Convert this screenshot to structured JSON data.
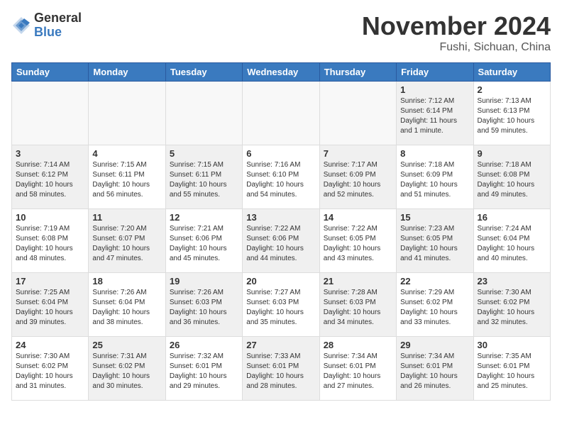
{
  "header": {
    "logo_general": "General",
    "logo_blue": "Blue",
    "month_title": "November 2024",
    "location": "Fushi, Sichuan, China"
  },
  "days_of_week": [
    "Sunday",
    "Monday",
    "Tuesday",
    "Wednesday",
    "Thursday",
    "Friday",
    "Saturday"
  ],
  "weeks": [
    [
      {
        "day": "",
        "info": "",
        "empty": true
      },
      {
        "day": "",
        "info": "",
        "empty": true
      },
      {
        "day": "",
        "info": "",
        "empty": true
      },
      {
        "day": "",
        "info": "",
        "empty": true
      },
      {
        "day": "",
        "info": "",
        "empty": true
      },
      {
        "day": "1",
        "info": "Sunrise: 7:12 AM\nSunset: 6:14 PM\nDaylight: 11 hours and 1 minute.",
        "shaded": true
      },
      {
        "day": "2",
        "info": "Sunrise: 7:13 AM\nSunset: 6:13 PM\nDaylight: 10 hours and 59 minutes.",
        "shaded": false
      }
    ],
    [
      {
        "day": "3",
        "info": "Sunrise: 7:14 AM\nSunset: 6:12 PM\nDaylight: 10 hours and 58 minutes.",
        "shaded": true
      },
      {
        "day": "4",
        "info": "Sunrise: 7:15 AM\nSunset: 6:11 PM\nDaylight: 10 hours and 56 minutes.",
        "shaded": false
      },
      {
        "day": "5",
        "info": "Sunrise: 7:15 AM\nSunset: 6:11 PM\nDaylight: 10 hours and 55 minutes.",
        "shaded": true
      },
      {
        "day": "6",
        "info": "Sunrise: 7:16 AM\nSunset: 6:10 PM\nDaylight: 10 hours and 54 minutes.",
        "shaded": false
      },
      {
        "day": "7",
        "info": "Sunrise: 7:17 AM\nSunset: 6:09 PM\nDaylight: 10 hours and 52 minutes.",
        "shaded": true
      },
      {
        "day": "8",
        "info": "Sunrise: 7:18 AM\nSunset: 6:09 PM\nDaylight: 10 hours and 51 minutes.",
        "shaded": false
      },
      {
        "day": "9",
        "info": "Sunrise: 7:18 AM\nSunset: 6:08 PM\nDaylight: 10 hours and 49 minutes.",
        "shaded": true
      }
    ],
    [
      {
        "day": "10",
        "info": "Sunrise: 7:19 AM\nSunset: 6:08 PM\nDaylight: 10 hours and 48 minutes.",
        "shaded": false
      },
      {
        "day": "11",
        "info": "Sunrise: 7:20 AM\nSunset: 6:07 PM\nDaylight: 10 hours and 47 minutes.",
        "shaded": true
      },
      {
        "day": "12",
        "info": "Sunrise: 7:21 AM\nSunset: 6:06 PM\nDaylight: 10 hours and 45 minutes.",
        "shaded": false
      },
      {
        "day": "13",
        "info": "Sunrise: 7:22 AM\nSunset: 6:06 PM\nDaylight: 10 hours and 44 minutes.",
        "shaded": true
      },
      {
        "day": "14",
        "info": "Sunrise: 7:22 AM\nSunset: 6:05 PM\nDaylight: 10 hours and 43 minutes.",
        "shaded": false
      },
      {
        "day": "15",
        "info": "Sunrise: 7:23 AM\nSunset: 6:05 PM\nDaylight: 10 hours and 41 minutes.",
        "shaded": true
      },
      {
        "day": "16",
        "info": "Sunrise: 7:24 AM\nSunset: 6:04 PM\nDaylight: 10 hours and 40 minutes.",
        "shaded": false
      }
    ],
    [
      {
        "day": "17",
        "info": "Sunrise: 7:25 AM\nSunset: 6:04 PM\nDaylight: 10 hours and 39 minutes.",
        "shaded": true
      },
      {
        "day": "18",
        "info": "Sunrise: 7:26 AM\nSunset: 6:04 PM\nDaylight: 10 hours and 38 minutes.",
        "shaded": false
      },
      {
        "day": "19",
        "info": "Sunrise: 7:26 AM\nSunset: 6:03 PM\nDaylight: 10 hours and 36 minutes.",
        "shaded": true
      },
      {
        "day": "20",
        "info": "Sunrise: 7:27 AM\nSunset: 6:03 PM\nDaylight: 10 hours and 35 minutes.",
        "shaded": false
      },
      {
        "day": "21",
        "info": "Sunrise: 7:28 AM\nSunset: 6:03 PM\nDaylight: 10 hours and 34 minutes.",
        "shaded": true
      },
      {
        "day": "22",
        "info": "Sunrise: 7:29 AM\nSunset: 6:02 PM\nDaylight: 10 hours and 33 minutes.",
        "shaded": false
      },
      {
        "day": "23",
        "info": "Sunrise: 7:30 AM\nSunset: 6:02 PM\nDaylight: 10 hours and 32 minutes.",
        "shaded": true
      }
    ],
    [
      {
        "day": "24",
        "info": "Sunrise: 7:30 AM\nSunset: 6:02 PM\nDaylight: 10 hours and 31 minutes.",
        "shaded": false
      },
      {
        "day": "25",
        "info": "Sunrise: 7:31 AM\nSunset: 6:02 PM\nDaylight: 10 hours and 30 minutes.",
        "shaded": true
      },
      {
        "day": "26",
        "info": "Sunrise: 7:32 AM\nSunset: 6:01 PM\nDaylight: 10 hours and 29 minutes.",
        "shaded": false
      },
      {
        "day": "27",
        "info": "Sunrise: 7:33 AM\nSunset: 6:01 PM\nDaylight: 10 hours and 28 minutes.",
        "shaded": true
      },
      {
        "day": "28",
        "info": "Sunrise: 7:34 AM\nSunset: 6:01 PM\nDaylight: 10 hours and 27 minutes.",
        "shaded": false
      },
      {
        "day": "29",
        "info": "Sunrise: 7:34 AM\nSunset: 6:01 PM\nDaylight: 10 hours and 26 minutes.",
        "shaded": true
      },
      {
        "day": "30",
        "info": "Sunrise: 7:35 AM\nSunset: 6:01 PM\nDaylight: 10 hours and 25 minutes.",
        "shaded": false
      }
    ]
  ]
}
